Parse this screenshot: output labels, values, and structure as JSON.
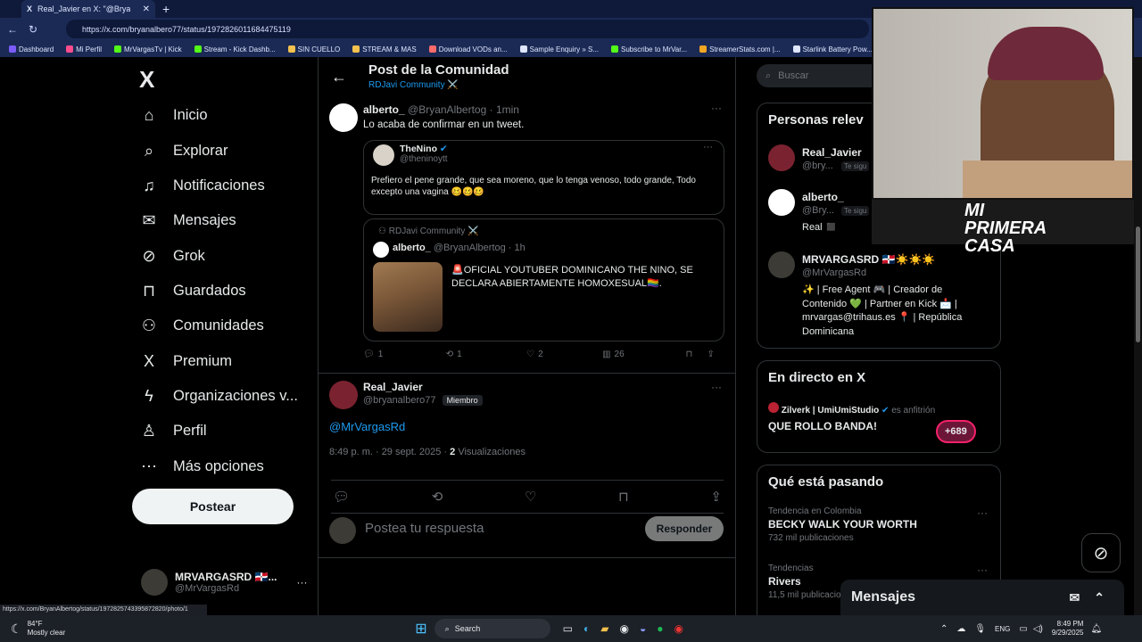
{
  "browser": {
    "tab_title": "Real_Javier en X: \"@BryanAlbertog",
    "url": "https://x.com/bryanalbero77/status/1972826011684475119",
    "bookmarks": [
      "Dashboard",
      "Mi Perfil",
      "MrVargasTv | Kick",
      "Stream - Kick Dashb...",
      "SIN CUELLO",
      "STREAM & MAS",
      "Download VODs an...",
      "Sample Enquiry » S...",
      "Subscribe to MrVar...",
      "StreamerStats.com |...",
      "Starlink Battery Pow..."
    ]
  },
  "nav": {
    "logo": "X",
    "items": [
      {
        "label": "Inicio",
        "icon": "home-icon",
        "glyph": "⌂"
      },
      {
        "label": "Explorar",
        "icon": "search-icon",
        "glyph": "⌕"
      },
      {
        "label": "Notificaciones",
        "icon": "bell-icon",
        "glyph": "♫"
      },
      {
        "label": "Mensajes",
        "icon": "mail-icon",
        "glyph": "✉"
      },
      {
        "label": "Grok",
        "icon": "grok-icon",
        "glyph": "⊘"
      },
      {
        "label": "Guardados",
        "icon": "bookmark-icon",
        "glyph": "⊓"
      },
      {
        "label": "Comunidades",
        "icon": "communities-icon",
        "glyph": "⚇"
      },
      {
        "label": "Premium",
        "icon": "x-premium-icon",
        "glyph": "X"
      },
      {
        "label": "Organizaciones v...",
        "icon": "lightning-icon",
        "glyph": "ϟ"
      },
      {
        "label": "Perfil",
        "icon": "person-icon",
        "glyph": "♙"
      },
      {
        "label": "Más opciones",
        "icon": "more-circle-icon",
        "glyph": "⋯"
      }
    ],
    "post_button": "Postear",
    "account": {
      "name": "MRVARGASRD 🇩🇴...",
      "handle": "@MrVargasRd",
      "more": "···"
    }
  },
  "header": {
    "title": "Post de la Comunidad",
    "subtitle": "RDJavi Community ⚔️"
  },
  "tweet": {
    "name": "alberto_",
    "handle": "@BryanAlbertog",
    "time": "· 1min",
    "text": "Lo acaba de confirmar en un tweet.",
    "quote": {
      "name": "TheNino",
      "handle": "@theninoytt",
      "text": "Prefiero el pene grande, que sea moreno, que lo tenga venoso, todo grande, Todo excepto una vagina 🥴🥴🥴"
    },
    "nested": {
      "community": "RDJavi Community ⚔️",
      "name": "alberto_",
      "handle": "@BryanAlbertog",
      "time": "· 1h",
      "text": "🚨OFICIAL YOUTUBER DOMINICANO THE NINO, SE DECLARA ABIERTAMENTE HOMOXESUAL🏳️‍🌈."
    },
    "stats": {
      "replies": "1",
      "retweets": "1",
      "likes": "2",
      "views": "26"
    }
  },
  "reply": {
    "name": "Real_Javier",
    "handle": "@bryanalbero77",
    "badge": "Miembro",
    "text": "@MrVargasRd",
    "meta_time": "8:49 p. m. · 29 sept. 2025 ·",
    "views_count": "2",
    "views_label": " Visualizaciones"
  },
  "compose": {
    "placeholder": "Postea tu respuesta",
    "button": "Responder"
  },
  "right": {
    "search_placeholder": "Buscar",
    "people_title": "Personas relev",
    "people": [
      {
        "name": "Real_Javier",
        "handle": "@bry...",
        "follows": "Te sigu"
      },
      {
        "name": "alberto_",
        "handle": "@Bry...",
        "follows": "Te sigu",
        "bio": "Real ◼️"
      },
      {
        "name": "MRVARGASRD 🇩🇴☀️☀️☀️",
        "handle": "@MrVargasRd",
        "bio": "✨ | Free Agent 🎮 | Creador de Contenido 💚 | Partner en Kick 📩 | mrvargas@trihaus.es 📍 | República Dominicana"
      }
    ],
    "live_title": "En directo en X",
    "live_host": "Zilverk | UmiUmiStudio",
    "live_host_suffix": "es anfitrión",
    "live_title_text": "QUE ROLLO BANDA!",
    "live_count": "+689",
    "trends_title": "Qué está pasando",
    "trends": [
      {
        "context": "Tendencia en Colombia",
        "name": "BECKY WALK YOUR WORTH",
        "count": "732 mil publicaciones"
      },
      {
        "context": "Tendencias",
        "name": "Rivers",
        "count": "11,5 mil publicacio"
      }
    ]
  },
  "messages_bar": "Mensajes",
  "status_url": "https://x.com/BryanAlbertog/status/1972825743395872820/photo/1",
  "taskbar": {
    "temp": "84°F",
    "weather": "Mostly clear",
    "search": "Search",
    "lang": "ENG",
    "time": "8:49 PM",
    "date": "9/29/2025"
  },
  "overlay_text": "MI PRIMERA CASA"
}
